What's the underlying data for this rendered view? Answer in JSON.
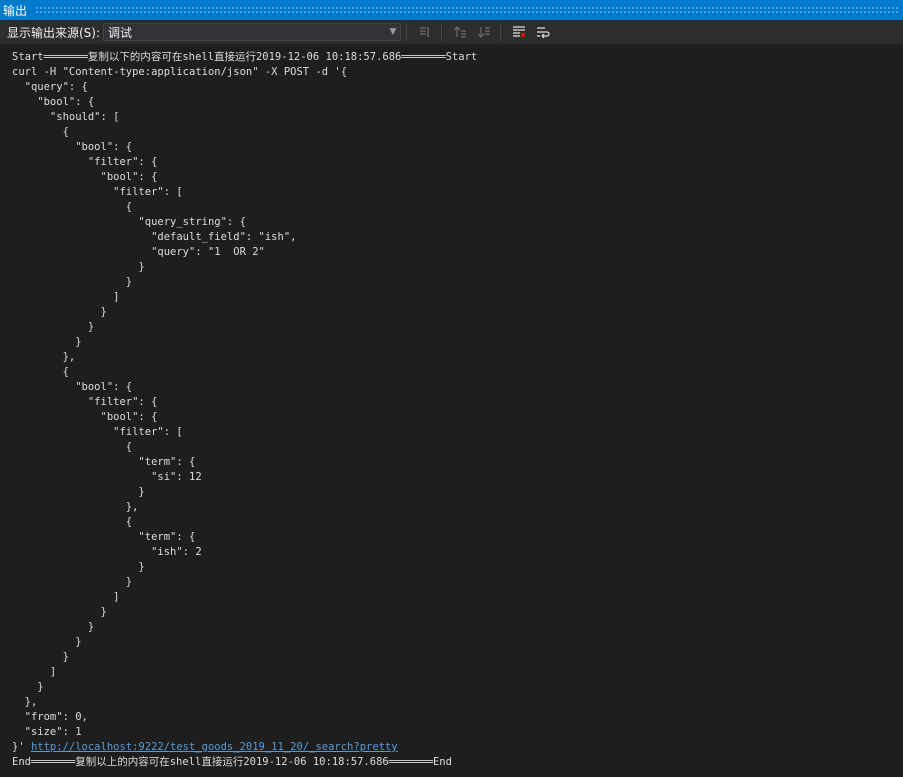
{
  "window": {
    "title": "输出"
  },
  "toolbar": {
    "source_label": "显示输出来源(S):",
    "source_value": "调试"
  },
  "output": {
    "lines_before": [
      "Start═══════复制以下的内容可在shell直接运行2019-12-06 10:18:57.686═══════Start",
      "curl -H \"Content-type:application/json\" -X POST -d '{",
      "  \"query\": {",
      "    \"bool\": {",
      "      \"should\": [",
      "        {",
      "          \"bool\": {",
      "            \"filter\": {",
      "              \"bool\": {",
      "                \"filter\": [",
      "                  {",
      "                    \"query_string\": {",
      "                      \"default_field\": \"ish\",",
      "                      \"query\": \"1  OR 2\"",
      "                    }",
      "                  }",
      "                ]",
      "              }",
      "            }",
      "          }",
      "        },",
      "        {",
      "          \"bool\": {",
      "            \"filter\": {",
      "              \"bool\": {",
      "                \"filter\": [",
      "                  {",
      "                    \"term\": {",
      "                      \"si\": 12",
      "                    }",
      "                  },",
      "                  {",
      "                    \"term\": {",
      "                      \"ish\": 2",
      "                    }",
      "                  }",
      "                ]",
      "              }",
      "            }",
      "          }",
      "        }",
      "      ]",
      "    }",
      "  },",
      "  \"from\": 0,",
      "  \"size\": 1"
    ],
    "link_prefix": "}' ",
    "link": "http://localhost:9222/test_goods_2019_11_20/_search?pretty",
    "end_line": "End═══════复制以上的内容可在shell直接运行2019-12-06 10:18:57.686═══════End"
  }
}
